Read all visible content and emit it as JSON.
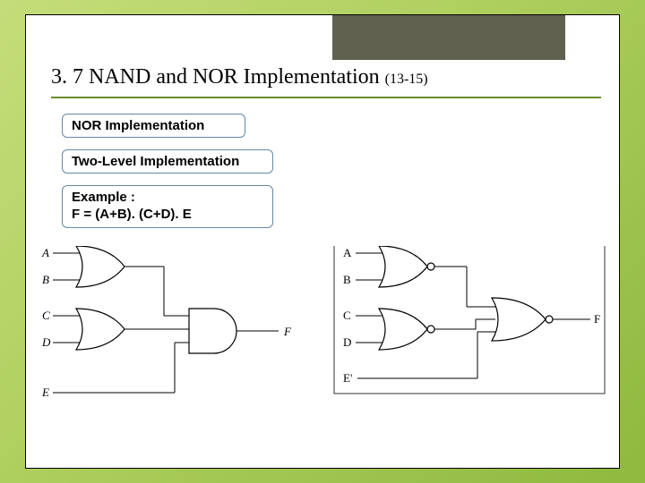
{
  "header": {
    "title_main": "3. 7 NAND and NOR Implementation ",
    "title_sub": "(13-15)"
  },
  "boxes": {
    "b1": "NOR Implementation",
    "b2": "Two-Level Implementation",
    "b3_l1": "Example :",
    "b3_l2": "F = (A+B). (C+D). E"
  },
  "diagram": {
    "left": {
      "inputs": {
        "A": "A",
        "B": "B",
        "C": "C",
        "D": "D",
        "E": "E"
      },
      "output": "F"
    },
    "right": {
      "inputs": {
        "A": "A",
        "B": "B",
        "C": "C",
        "D": "D",
        "E": "E'"
      },
      "output": "F"
    }
  }
}
